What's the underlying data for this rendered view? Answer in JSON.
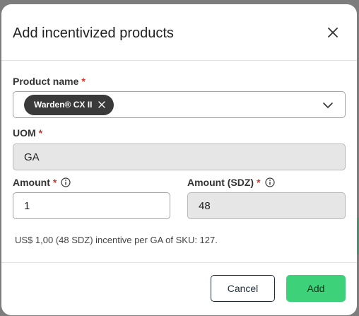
{
  "modal": {
    "title": "Add incentivized products"
  },
  "product": {
    "label": "Product name",
    "required_mark": "*",
    "selected_chip": "Warden® CX II"
  },
  "uom": {
    "label": "UOM",
    "required_mark": "*",
    "value": "GA"
  },
  "amount": {
    "label": "Amount",
    "required_mark": "*",
    "value": "1"
  },
  "amount_sdz": {
    "label": "Amount (SDZ)",
    "required_mark": "*",
    "value": "48"
  },
  "helper_text": "US$ 1,00 (48 SDZ) incentive per GA of SKU: 127.",
  "footer": {
    "cancel_label": "Cancel",
    "add_label": "Add"
  },
  "colors": {
    "primary": "#3dd179",
    "required": "#d0342c",
    "chip_bg": "#3a3a3a"
  }
}
